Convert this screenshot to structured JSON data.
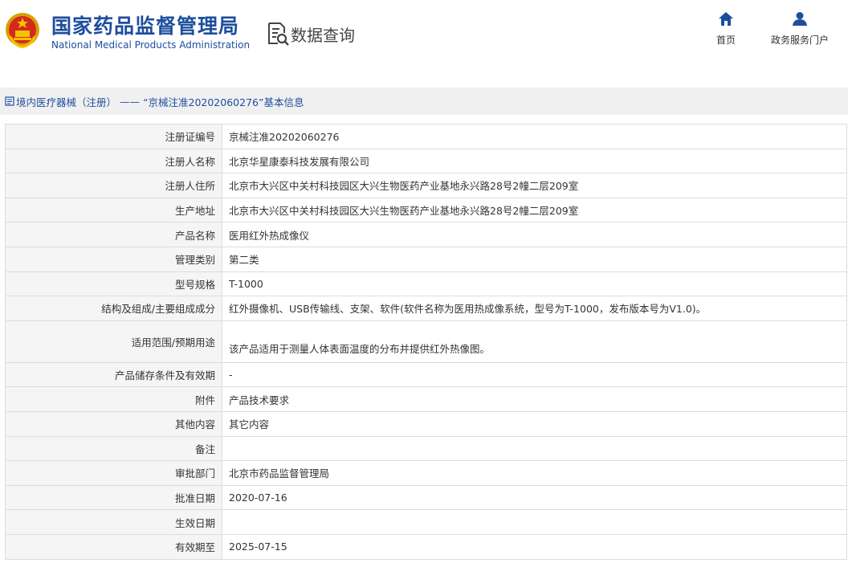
{
  "header": {
    "logo_cn": "国家药品监督管理局",
    "logo_en": "National Medical Products Administration",
    "section_title": "数据查询",
    "nav": [
      {
        "label": "首页",
        "icon": "home-icon"
      },
      {
        "label": "政务服务门户",
        "icon": "user-icon"
      }
    ],
    "brand_color": "#1d4e9e"
  },
  "breadcrumb": {
    "link": "境内医疗器械（注册）",
    "separator": "——",
    "current": "“京械注准20202060276”基本信息"
  },
  "rows": [
    {
      "label": "注册证编号",
      "value": "京械注准20202060276"
    },
    {
      "label": "注册人名称",
      "value": "北京华星康泰科技发展有限公司"
    },
    {
      "label": "注册人住所",
      "value": "北京市大兴区中关村科技园区大兴生物医药产业基地永兴路28号2幢二层209室"
    },
    {
      "label": "生产地址",
      "value": "北京市大兴区中关村科技园区大兴生物医药产业基地永兴路28号2幢二层209室"
    },
    {
      "label": "产品名称",
      "value": "医用红外热成像仪"
    },
    {
      "label": "管理类别",
      "value": "第二类"
    },
    {
      "label": "型号规格",
      "value": "T-1000"
    },
    {
      "label": "结构及组成/主要组成成分",
      "value": "红外摄像机、USB传输线、支架、软件(软件名称为医用热成像系统，型号为T-1000，发布版本号为V1.0)。"
    },
    {
      "label": "适用范围/预期用途",
      "value": "该产品适用于测量人体表面温度的分布并提供红外热像图。"
    },
    {
      "label": "产品储存条件及有效期",
      "value": "-"
    },
    {
      "label": "附件",
      "value": "产品技术要求"
    },
    {
      "label": "其他内容",
      "value": "其它内容"
    },
    {
      "label": "备注",
      "value": ""
    },
    {
      "label": "审批部门",
      "value": "北京市药品监督管理局"
    },
    {
      "label": "批准日期",
      "value": "2020-07-16"
    },
    {
      "label": "生效日期",
      "value": ""
    },
    {
      "label": "有效期至",
      "value": "2025-07-15"
    }
  ]
}
